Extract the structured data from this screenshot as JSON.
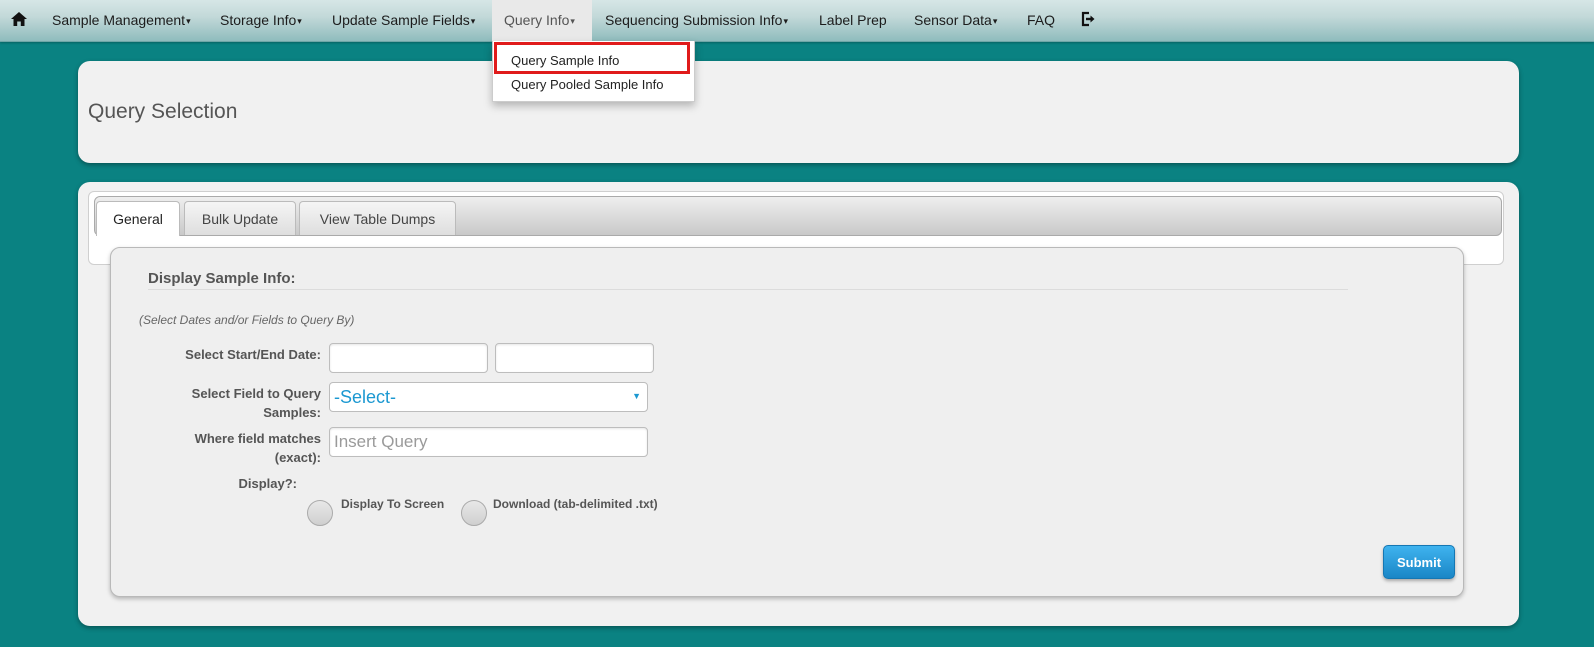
{
  "nav": {
    "items": [
      {
        "label": "Sample Management",
        "caret": "▾"
      },
      {
        "label": "Storage Info",
        "caret": "▾"
      },
      {
        "label": "Update Sample Fields",
        "caret": "▾"
      },
      {
        "label": "Query Info",
        "caret": "▾"
      },
      {
        "label": "Sequencing Submission Info",
        "caret": "▾"
      },
      {
        "label": "Label Prep"
      },
      {
        "label": "Sensor Data",
        "caret": "▾"
      },
      {
        "label": "FAQ"
      }
    ],
    "icons": {
      "home": "home-icon",
      "logout": "logout-icon"
    }
  },
  "dropdown": {
    "items": [
      "Query Sample Info",
      "Query Pooled Sample Info"
    ]
  },
  "header": {
    "title": "Query Selection"
  },
  "tabs": [
    "General",
    "Bulk Update",
    "View Table Dumps"
  ],
  "form": {
    "section_title": "Display Sample Info:",
    "hint": "(Select Dates and/or Fields to Query By)",
    "date_label": "Select Start/End Date:",
    "field_label_1": "Select Field to Query",
    "field_label_2": "Samples:",
    "field_select_value": "-Select-",
    "match_label_1": "Where field matches",
    "match_label_2": "(exact):",
    "match_placeholder": "Insert Query",
    "display_label": "Display?:",
    "radio_screen": "Display To Screen",
    "radio_download": "Download (tab-delimited .txt)",
    "submit": "Submit"
  },
  "colors": {
    "background": "#0a8282",
    "accent": "#1b98d1",
    "highlight": "#e01b1b"
  }
}
